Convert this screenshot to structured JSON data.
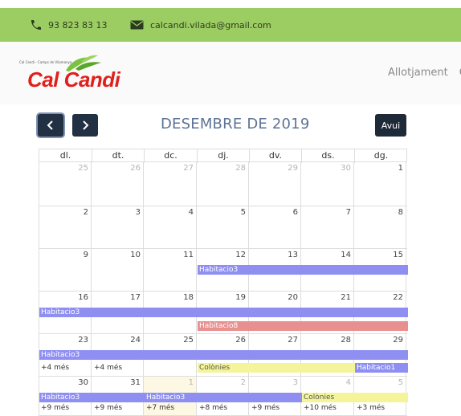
{
  "topbar": {
    "phone": "93 823 83 13",
    "email": "calcandi.vilada@gmail.com",
    "phone_icon": "phone-icon",
    "email_icon": "envelope-icon"
  },
  "header": {
    "logo_tagline": "Cal Candi - Camps de Vilamanya",
    "logo_name": "Cal Candi",
    "nav_item": "Allotjament",
    "nav_next_cut": "C"
  },
  "toolbar": {
    "prev_icon": "chevron-left-icon",
    "next_icon": "chevron-right-icon",
    "title": "DESEMBRE DE 2019",
    "today_label": "Avui"
  },
  "colors": {
    "topbar": "#9ccd63",
    "brand_red": "#e0201b",
    "event_blue": "#8f8ff2",
    "event_red": "#e88f8f",
    "event_yellow": "#f4f49a",
    "today_bg": "#fcf8e3"
  },
  "calendar": {
    "days": [
      "dl.",
      "dt.",
      "dc.",
      "dj.",
      "dv.",
      "ds.",
      "dg."
    ],
    "weeks": [
      {
        "dates": [
          "25",
          "26",
          "27",
          "28",
          "29",
          "30",
          "1"
        ],
        "other": [
          1,
          1,
          1,
          1,
          1,
          1,
          0
        ]
      },
      {
        "dates": [
          "2",
          "3",
          "4",
          "5",
          "6",
          "7",
          "8"
        ],
        "other": [
          0,
          0,
          0,
          0,
          0,
          0,
          0
        ]
      },
      {
        "dates": [
          "9",
          "10",
          "11",
          "12",
          "13",
          "14",
          "15"
        ],
        "other": [
          0,
          0,
          0,
          0,
          0,
          0,
          0
        ]
      },
      {
        "dates": [
          "16",
          "17",
          "18",
          "19",
          "20",
          "21",
          "22"
        ],
        "other": [
          0,
          0,
          0,
          0,
          0,
          0,
          0
        ]
      },
      {
        "dates": [
          "23",
          "24",
          "25",
          "26",
          "27",
          "28",
          "29"
        ],
        "other": [
          0,
          0,
          0,
          0,
          0,
          0,
          0
        ]
      },
      {
        "dates": [
          "30",
          "31",
          "1",
          "2",
          "3",
          "4",
          "5"
        ],
        "other": [
          0,
          0,
          1,
          1,
          1,
          1,
          1
        ]
      }
    ],
    "events": {
      "w3_habitacio3": "Habitacio3",
      "w4_habitacio3": "Habitacio3",
      "w4_habitacio8": "Habitacio8",
      "w5_habitacio3": "Habitacio3",
      "w5_colonies": "Colònies",
      "w5_habitacio1": "Habitacio1",
      "w6_habitacio3_a": "Habitacio3",
      "w6_habitacio3_b": "Habitacio3",
      "w6_colonies": "Colònies"
    },
    "more": {
      "w5_mon": "+4 més",
      "w5_tue": "+4 més",
      "w6_mon": "+9 més",
      "w6_tue": "+9 més",
      "w6_wed": "+7 més",
      "w6_thu": "+8 més",
      "w6_fri": "+9 més",
      "w6_sat": "+10 més",
      "w6_sun": "+3 més"
    }
  }
}
